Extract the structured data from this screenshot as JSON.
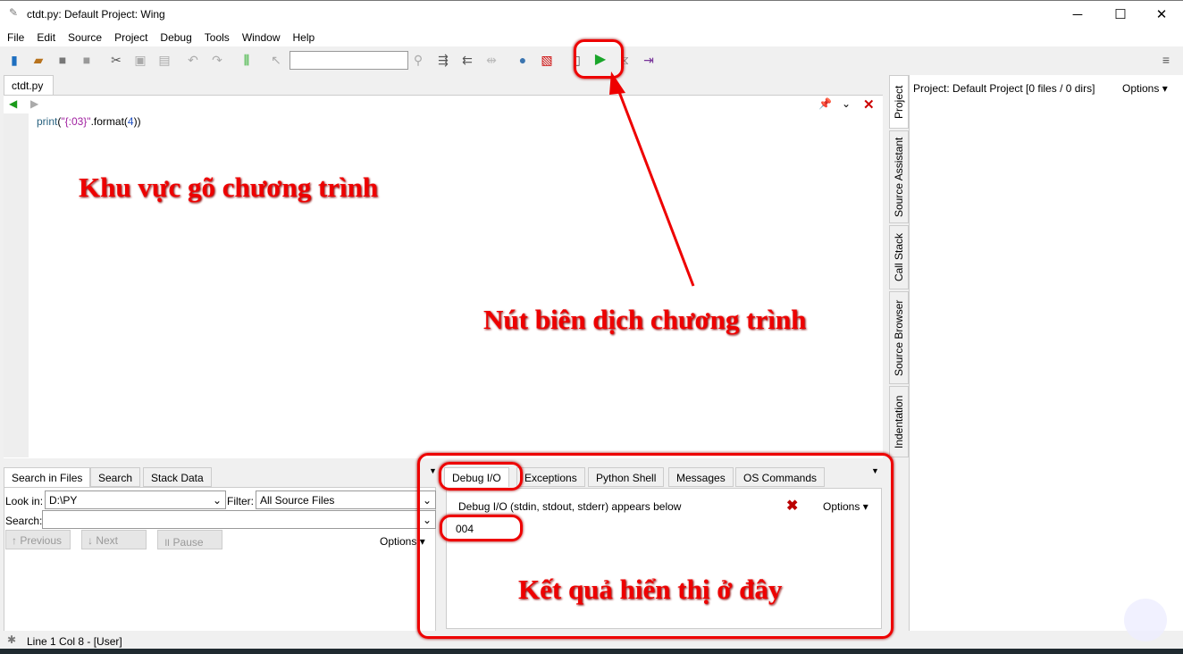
{
  "window": {
    "title": "ctdt.py: Default Project: Wing",
    "minimize": "─",
    "maximize": "☐",
    "close": "✕"
  },
  "menu": [
    "File",
    "Edit",
    "Source",
    "Project",
    "Debug",
    "Tools",
    "Window",
    "Help"
  ],
  "toolbar": {
    "search_value": "",
    "icons": [
      "new-file",
      "open-folder",
      "save",
      "save-all",
      "cut",
      "copy",
      "paste",
      "undo",
      "redo",
      "indent-guide",
      "select",
      "search",
      "indent-right",
      "indent-left",
      "indent-toggle",
      "python",
      "debug-tool",
      "new-doc",
      "run",
      "step",
      "step-into",
      "menu"
    ]
  },
  "editor": {
    "tab": "ctdt.py",
    "code": {
      "fn": "print",
      "open": "(",
      "str": "\"{:03}\"",
      "method": ".format(",
      "arg": "4",
      "close": "))"
    }
  },
  "search_panel": {
    "tabs": [
      "Search in Files",
      "Search",
      "Stack Data"
    ],
    "look_in_label": "Look in:",
    "look_in_value": "D:\\PY",
    "filter_label": "Filter:",
    "filter_value": "All Source Files",
    "search_label": "Search:",
    "search_value": "",
    "previous": "Previous",
    "next": "Next",
    "pause": "Pause",
    "options": "Options"
  },
  "debug_panel": {
    "tabs": [
      "Debug I/O",
      "Exceptions",
      "Python Shell",
      "Messages",
      "OS Commands"
    ],
    "header": "Debug I/O (stdin, stdout, stderr) appears below",
    "options": "Options",
    "output": "004"
  },
  "right_panel": {
    "header": "Project: Default Project [0 files / 0 dirs]",
    "options": "Options",
    "tabs": [
      "Project",
      "Source Assistant",
      "Call Stack",
      "Source Browser",
      "Indentation"
    ]
  },
  "status": {
    "text": "Line 1 Col 8 - [User]"
  },
  "annotations": {
    "editor": "Khu vực gõ chương trình",
    "run": "Nút biên dịch chương trình",
    "output": "Kết quả hiển thị ở đây",
    "color": "#e00000"
  },
  "watermark": "BTN"
}
